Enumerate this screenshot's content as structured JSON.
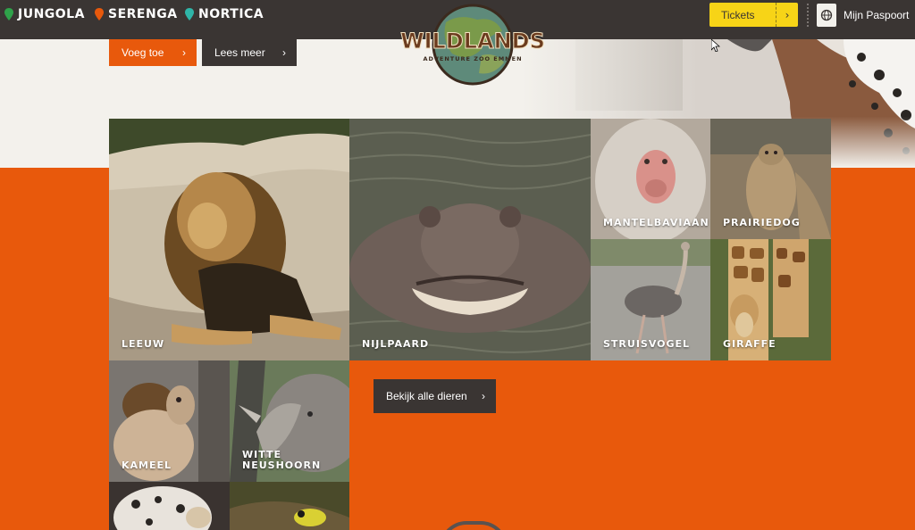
{
  "nav": {
    "regions": [
      {
        "label": "JUNGOLA",
        "color": "#2fa24a"
      },
      {
        "label": "SERENGA",
        "color": "#e8590c"
      },
      {
        "label": "NORTICA",
        "color": "#2fb5a8"
      }
    ],
    "tickets_label": "Tickets",
    "passport_label": "Mijn Paspoort"
  },
  "logo": {
    "title": "WILDLANDS",
    "subtitle": "ADVENTURE ZOO EMMEN"
  },
  "hero": {
    "add_label": "Voeg toe",
    "read_more_label": "Lees meer"
  },
  "animals": [
    {
      "name": "LEEUW"
    },
    {
      "name": "NIJLPAARD"
    },
    {
      "name": "MANTELBAVIAAN"
    },
    {
      "name": "PRAIRIEDOG"
    },
    {
      "name": "STRUISVOGEL"
    },
    {
      "name": "GIRAFFE"
    },
    {
      "name": "KAMEEL"
    },
    {
      "name": "WITTE NEUSHOORN"
    }
  ],
  "view_all_label": "Bekijk alle dieren",
  "colors": {
    "accent": "#e8590c",
    "dark": "#3a3533",
    "yellow": "#f7d417"
  }
}
